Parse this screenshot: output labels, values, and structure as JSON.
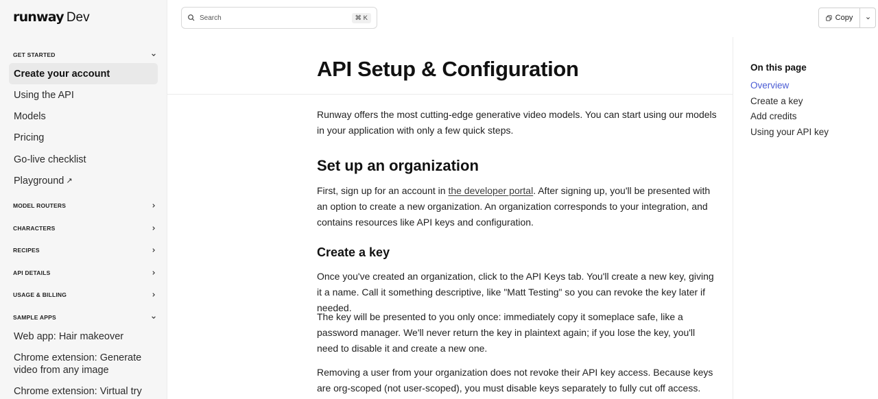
{
  "logo": {
    "brand": "runway",
    "suffix": "Dev"
  },
  "search": {
    "placeholder": "Search",
    "shortcut": "⌘ K"
  },
  "actions": {
    "copy_label": "Copy"
  },
  "sidebar": {
    "get_started_label": "GET STARTED",
    "get_started_items": [
      "Create your account",
      "Using the API",
      "Models",
      "Pricing",
      "Go-live checklist",
      "Playground"
    ],
    "playground_ext": "↗",
    "sections": [
      "MODEL ROUTERS",
      "CHARACTERS",
      "RECIPES",
      "API DETAILS",
      "USAGE & BILLING"
    ],
    "sample_apps_label": "SAMPLE APPS",
    "sample_apps_items": [
      "Web app: Hair makeover",
      "Chrome extension: Generate video from any image",
      "Chrome extension: Virtual try on"
    ]
  },
  "page": {
    "title": "API Setup & Configuration",
    "intro": "Runway offers the most cutting-edge generative video models. You can start using our models in your application with only a few quick steps.",
    "h_org": "Set up an organization",
    "org_text_before": "First, sign up for an account in ",
    "org_link": "the developer portal",
    "org_text_after": ". After signing up, you'll be presented with an option to create a new organization. An organization corresponds to your integration, and contains resources like API keys and configuration.",
    "h_key": "Create a key",
    "key_p1": "Once you've created an organization, click to the API Keys tab. You'll create a new key, giving it a name. Call it something descriptive, like \"Matt Testing\" so you can revoke the key later if needed.",
    "key_p2": "The key will be presented to you only once: immediately copy it someplace safe, like a password manager. We'll never return the key in plaintext again; if you lose the key, you'll need to disable it and create a new one.",
    "key_p3": "Removing a user from your organization does not revoke their API key access. Because keys are org-scoped (not user-scoped), you must disable keys separately to fully cut off access."
  },
  "toc": {
    "title": "On this page",
    "items": [
      "Overview",
      "Create a key",
      "Add credits",
      "Using your API key"
    ]
  },
  "colors": {
    "accent": "#4a5bd4",
    "sidebar_bg": "#f6f6f6",
    "active_bg": "#e9e9e9"
  }
}
